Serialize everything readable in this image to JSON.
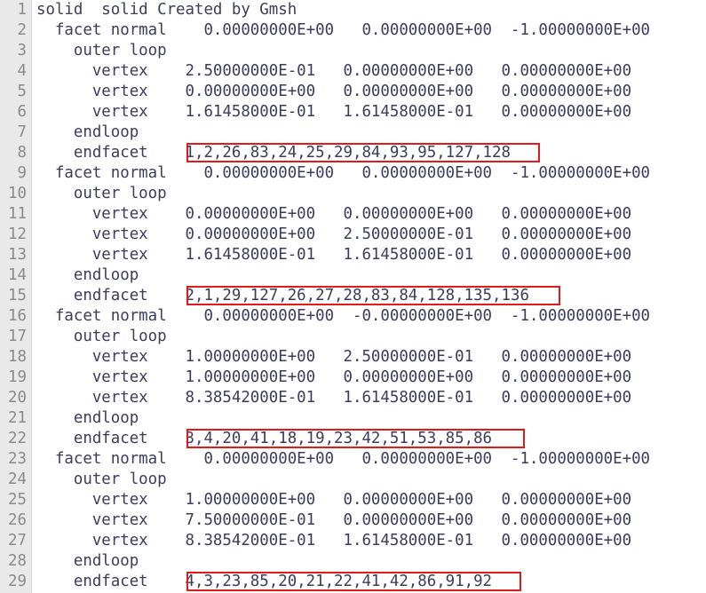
{
  "editor": {
    "lines": [
      {
        "num": "1",
        "text": "solid  solid Created by Gmsh"
      },
      {
        "num": "2",
        "text": "  facet normal    0.00000000E+00   0.00000000E+00  -1.00000000E+00"
      },
      {
        "num": "3",
        "text": "    outer loop"
      },
      {
        "num": "4",
        "text": "      vertex    2.50000000E-01   0.00000000E+00   0.00000000E+00"
      },
      {
        "num": "5",
        "text": "      vertex    0.00000000E+00   0.00000000E+00   0.00000000E+00"
      },
      {
        "num": "6",
        "text": "      vertex    1.61458000E-01   1.61458000E-01   0.00000000E+00"
      },
      {
        "num": "7",
        "text": "    endloop"
      },
      {
        "num": "8",
        "text": "    endfacet    1,2,26,83,24,25,29,84,93,95,127,128"
      },
      {
        "num": "9",
        "text": "  facet normal    0.00000000E+00   0.00000000E+00  -1.00000000E+00"
      },
      {
        "num": "10",
        "text": "    outer loop"
      },
      {
        "num": "11",
        "text": "      vertex    0.00000000E+00   0.00000000E+00   0.00000000E+00"
      },
      {
        "num": "12",
        "text": "      vertex    0.00000000E+00   2.50000000E-01   0.00000000E+00"
      },
      {
        "num": "13",
        "text": "      vertex    1.61458000E-01   1.61458000E-01   0.00000000E+00"
      },
      {
        "num": "14",
        "text": "    endloop"
      },
      {
        "num": "15",
        "text": "    endfacet    2,1,29,127,26,27,28,83,84,128,135,136"
      },
      {
        "num": "16",
        "text": "  facet normal    0.00000000E+00  -0.00000000E+00  -1.00000000E+00"
      },
      {
        "num": "17",
        "text": "    outer loop"
      },
      {
        "num": "18",
        "text": "      vertex    1.00000000E+00   2.50000000E-01   0.00000000E+00"
      },
      {
        "num": "19",
        "text": "      vertex    1.00000000E+00   0.00000000E+00   0.00000000E+00"
      },
      {
        "num": "20",
        "text": "      vertex    8.38542000E-01   1.61458000E-01   0.00000000E+00"
      },
      {
        "num": "21",
        "text": "    endloop"
      },
      {
        "num": "22",
        "text": "    endfacet    3,4,20,41,18,19,23,42,51,53,85,86"
      },
      {
        "num": "23",
        "text": "  facet normal    0.00000000E+00   0.00000000E+00  -1.00000000E+00"
      },
      {
        "num": "24",
        "text": "    outer loop"
      },
      {
        "num": "25",
        "text": "      vertex    1.00000000E+00   0.00000000E+00   0.00000000E+00"
      },
      {
        "num": "26",
        "text": "      vertex    7.50000000E-01   0.00000000E+00   0.00000000E+00"
      },
      {
        "num": "27",
        "text": "      vertex    8.38542000E-01   1.61458000E-01   0.00000000E+00"
      },
      {
        "num": "28",
        "text": "    endloop"
      },
      {
        "num": "29",
        "text": "    endfacet    4,3,23,85,20,21,22,41,42,86,91,92"
      }
    ],
    "highlight_color": "#e01b1b"
  }
}
